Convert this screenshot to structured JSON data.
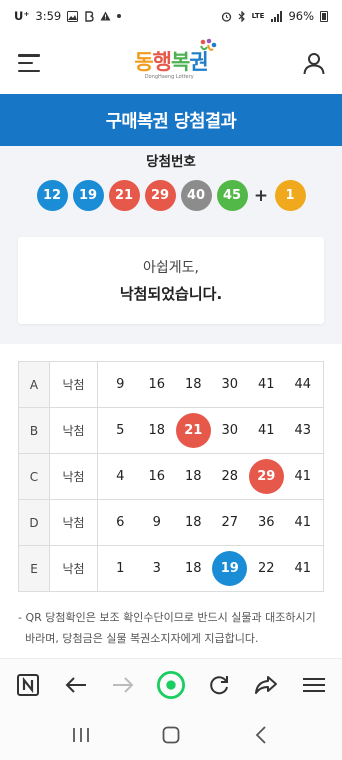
{
  "status_bar": {
    "carrier": "U⁺",
    "time": "3:59",
    "network": "LTE",
    "battery": "96%"
  },
  "header": {
    "logo_text": [
      "동",
      "행",
      "복",
      "권"
    ],
    "logo_subtext": "DongHaeng Lottery"
  },
  "title": "구매복권 당첨결과",
  "winning": {
    "label": "당첨번호",
    "numbers": [
      {
        "value": "12",
        "color": "#1b8cd6"
      },
      {
        "value": "19",
        "color": "#1b8cd6"
      },
      {
        "value": "21",
        "color": "#e5584a"
      },
      {
        "value": "29",
        "color": "#e5584a"
      },
      {
        "value": "40",
        "color": "#8c8c8c"
      },
      {
        "value": "45",
        "color": "#52b848"
      }
    ],
    "plus": "+",
    "bonus": {
      "value": "1",
      "color": "#f0a81d"
    }
  },
  "result": {
    "line1": "아쉽게도,",
    "line2": "낙첨되었습니다."
  },
  "tickets": [
    {
      "label": "A",
      "status": "낙첨",
      "numbers": [
        {
          "value": "9"
        },
        {
          "value": "16"
        },
        {
          "value": "18"
        },
        {
          "value": "30"
        },
        {
          "value": "41"
        },
        {
          "value": "44"
        }
      ]
    },
    {
      "label": "B",
      "status": "낙첨",
      "numbers": [
        {
          "value": "5"
        },
        {
          "value": "18"
        },
        {
          "value": "21",
          "hit_color": "#e5584a"
        },
        {
          "value": "30"
        },
        {
          "value": "41"
        },
        {
          "value": "43"
        }
      ]
    },
    {
      "label": "C",
      "status": "낙첨",
      "numbers": [
        {
          "value": "4"
        },
        {
          "value": "16"
        },
        {
          "value": "18"
        },
        {
          "value": "28"
        },
        {
          "value": "29",
          "hit_color": "#e5584a"
        },
        {
          "value": "41"
        }
      ]
    },
    {
      "label": "D",
      "status": "낙첨",
      "numbers": [
        {
          "value": "6"
        },
        {
          "value": "9"
        },
        {
          "value": "18"
        },
        {
          "value": "27"
        },
        {
          "value": "36"
        },
        {
          "value": "41"
        }
      ]
    },
    {
      "label": "E",
      "status": "낙첨",
      "numbers": [
        {
          "value": "1"
        },
        {
          "value": "3"
        },
        {
          "value": "18"
        },
        {
          "value": "19",
          "hit_color": "#1b8cd6"
        },
        {
          "value": "22"
        },
        {
          "value": "41"
        }
      ]
    }
  ],
  "notice": {
    "line1": "- QR 당첨확인은 보조 확인수단이므로 반드시 실물과 대조하시기",
    "line2": "  바라며, 당첨금은 실물 복권소지자에게 지급합니다."
  },
  "browser_bar": {
    "icons": [
      "naver-icon",
      "back-arrow-icon",
      "forward-arrow-icon",
      "home-green-icon",
      "refresh-icon",
      "share-icon",
      "menu-icon"
    ],
    "accent_color": "#19ce60"
  },
  "nav_bar": {
    "icons": [
      "recents-icon",
      "home-icon",
      "back-icon"
    ]
  },
  "colors": {
    "brand_blue": "#1876c6",
    "panel_bg": "#f2f4f7"
  }
}
